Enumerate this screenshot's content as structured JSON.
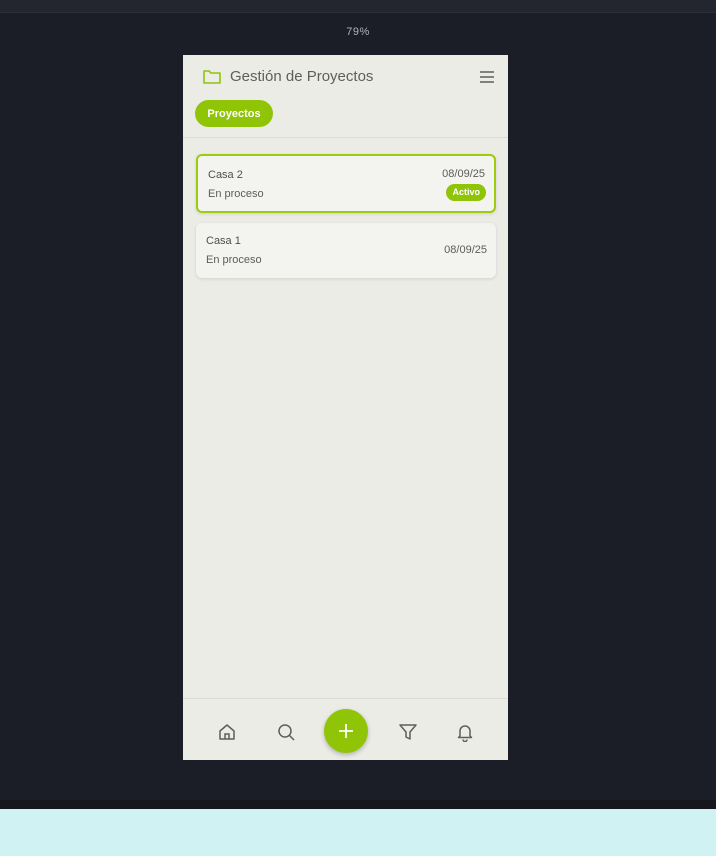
{
  "browser": {
    "zoom_label": "79%"
  },
  "header": {
    "title": "Gestión de Proyectos"
  },
  "filter": {
    "chip_label": "Proyectos"
  },
  "projects": [
    {
      "name": "Casa 2",
      "status": "En proceso",
      "date": "08/09/25",
      "badge": "Activo",
      "active": true
    },
    {
      "name": "Casa 1",
      "status": "En proceso",
      "date": "08/09/25",
      "active": false
    }
  ],
  "bottom_nav": {
    "items": [
      "home-icon",
      "search-icon",
      "add-icon",
      "filter-icon",
      "bell-icon"
    ]
  },
  "colors": {
    "accent": "#8fc407",
    "background": "#ecece7",
    "page_bg": "#1b1e26"
  }
}
